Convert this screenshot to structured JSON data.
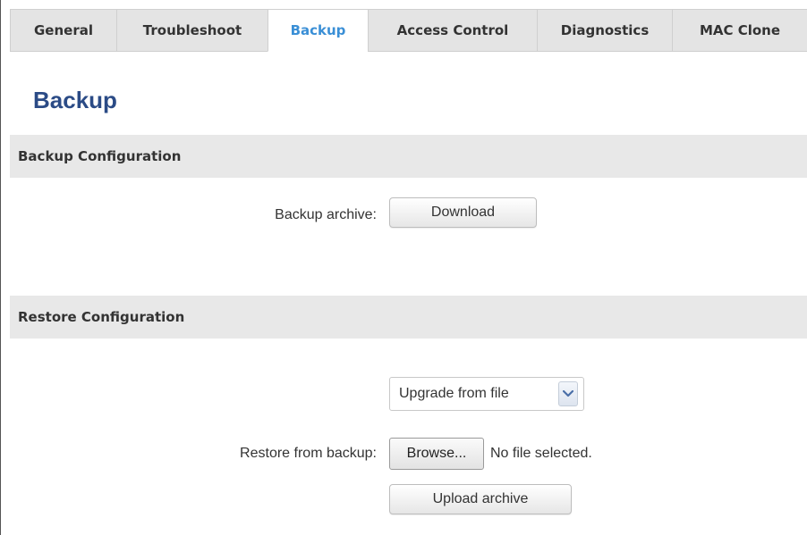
{
  "tabs": [
    {
      "label": "General",
      "active": false
    },
    {
      "label": "Troubleshoot",
      "active": false
    },
    {
      "label": "Backup",
      "active": true
    },
    {
      "label": "Access Control",
      "active": false
    },
    {
      "label": "Diagnostics",
      "active": false
    },
    {
      "label": "MAC Clone",
      "active": false
    }
  ],
  "page": {
    "title": "Backup"
  },
  "backup_section": {
    "header": "Backup Configuration",
    "archive_label": "Backup archive:",
    "download_button": "Download"
  },
  "restore_section": {
    "header": "Restore Configuration",
    "mode_select": {
      "value": "Upgrade from file",
      "icon": "chevron-down-icon"
    },
    "restore_label": "Restore from backup:",
    "browse_button": "Browse...",
    "file_status": "No file selected.",
    "upload_button": "Upload archive"
  },
  "colors": {
    "active_tab_text": "#3a8fd6",
    "title": "#2b4b86",
    "section_bg": "#e8e8e8"
  }
}
